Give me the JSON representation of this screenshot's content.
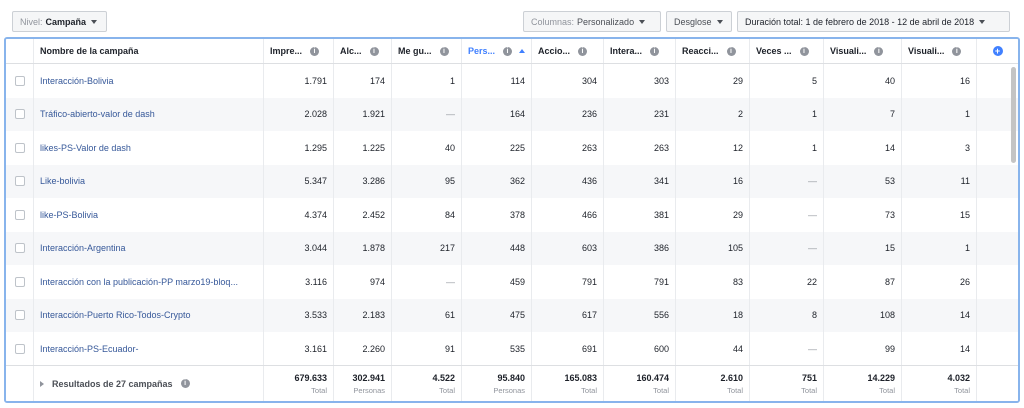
{
  "toolbar": {
    "level_prefix": "Nivel:",
    "level_value": "Campaña",
    "columns_prefix": "Columnas:",
    "columns_value": "Personalizado",
    "breakdown_label": "Desglose",
    "duration_label": "Duración total: 1 de febrero de 2018 - 12 de abril de 2018"
  },
  "table": {
    "headers": [
      {
        "label": "Nombre de la campaña"
      },
      {
        "label": "Impre...",
        "info": "i"
      },
      {
        "label": "Alc...",
        "info": "i"
      },
      {
        "label": "Me gu...",
        "info": "i"
      },
      {
        "label": "Pers...",
        "info": "i",
        "sorted": true
      },
      {
        "label": "Accio...",
        "info": "i"
      },
      {
        "label": "Intera...",
        "info": "i"
      },
      {
        "label": "Reacci...",
        "info": "i"
      },
      {
        "label": "Veces ...",
        "info": "i"
      },
      {
        "label": "Visuali...",
        "info": "i"
      },
      {
        "label": "Visuali...",
        "info": "i"
      }
    ],
    "add_column_symbol": "+",
    "rows": [
      [
        "Interacción-Bolivia",
        "1.791",
        "174",
        "1",
        "114",
        "304",
        "303",
        "29",
        "5",
        "40",
        "16"
      ],
      [
        "Tráfico-abierto-valor de dash",
        "2.028",
        "1.921",
        "—",
        "164",
        "236",
        "231",
        "2",
        "1",
        "7",
        "1"
      ],
      [
        "likes-PS-Valor de dash",
        "1.295",
        "1.225",
        "40",
        "225",
        "263",
        "263",
        "12",
        "1",
        "14",
        "3"
      ],
      [
        "Like-bolivia",
        "5.347",
        "3.286",
        "95",
        "362",
        "436",
        "341",
        "16",
        "—",
        "53",
        "11"
      ],
      [
        "like-PS-Bolivia",
        "4.374",
        "2.452",
        "84",
        "378",
        "466",
        "381",
        "29",
        "—",
        "73",
        "15"
      ],
      [
        "Interacción-Argentina",
        "3.044",
        "1.878",
        "217",
        "448",
        "603",
        "386",
        "105",
        "—",
        "15",
        "1"
      ],
      [
        "Interacción con la publicación-PP marzo19-bloq...",
        "3.116",
        "974",
        "—",
        "459",
        "791",
        "791",
        "83",
        "22",
        "87",
        "26"
      ],
      [
        "Interacción-Puerto Rico-Todos-Crypto",
        "3.533",
        "2.183",
        "61",
        "475",
        "617",
        "556",
        "18",
        "8",
        "108",
        "14"
      ],
      [
        "Interacción-PS-Ecuador-",
        "3.161",
        "2.260",
        "91",
        "535",
        "691",
        "600",
        "44",
        "—",
        "99",
        "14"
      ]
    ],
    "footer": {
      "label": "Resultados de 27 campañas",
      "info": "i",
      "totals": [
        {
          "value": "679.633",
          "unit": "Total"
        },
        {
          "value": "302.941",
          "unit": "Personas"
        },
        {
          "value": "4.522",
          "unit": "Total"
        },
        {
          "value": "95.840",
          "unit": "Personas"
        },
        {
          "value": "165.083",
          "unit": "Total"
        },
        {
          "value": "160.474",
          "unit": "Total"
        },
        {
          "value": "2.610",
          "unit": "Total"
        },
        {
          "value": "751",
          "unit": "Total"
        },
        {
          "value": "14.229",
          "unit": "Total"
        },
        {
          "value": "4.032",
          "unit": "Total"
        }
      ]
    }
  },
  "colors": {
    "accent": "#4080ff",
    "link": "#365899",
    "frame": "#88b4ec"
  }
}
